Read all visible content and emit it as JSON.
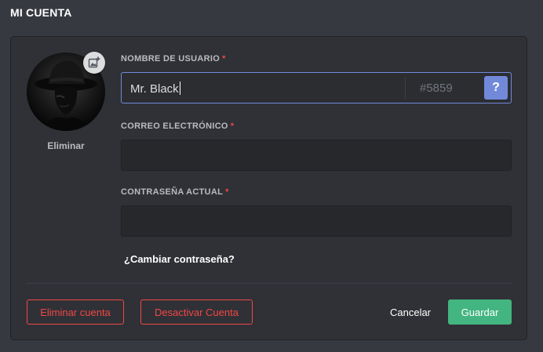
{
  "page": {
    "title": "MI CUENTA"
  },
  "avatar": {
    "icon": "add-image-icon",
    "remove_label": "Eliminar"
  },
  "username": {
    "label": "NOMBRE DE USUARIO",
    "required_mark": "*",
    "value": "Mr. Black",
    "discriminator": "#5859",
    "help_label": "?"
  },
  "email": {
    "label": "CORREO ELECTRÓNICO",
    "required_mark": "*",
    "value": ""
  },
  "password": {
    "label": "CONTRASEÑA ACTUAL",
    "required_mark": "*",
    "value": ""
  },
  "links": {
    "change_password": "¿Cambiar contraseña?"
  },
  "actions": {
    "delete_account": "Eliminar cuenta",
    "deactivate_account": "Desactivar Cuenta",
    "cancel": "Cancelar",
    "save": "Guardar"
  },
  "colors": {
    "background": "#36393f",
    "card": "#2f3136",
    "accent": "#7289da",
    "danger": "#f04747",
    "success": "#43b581"
  }
}
